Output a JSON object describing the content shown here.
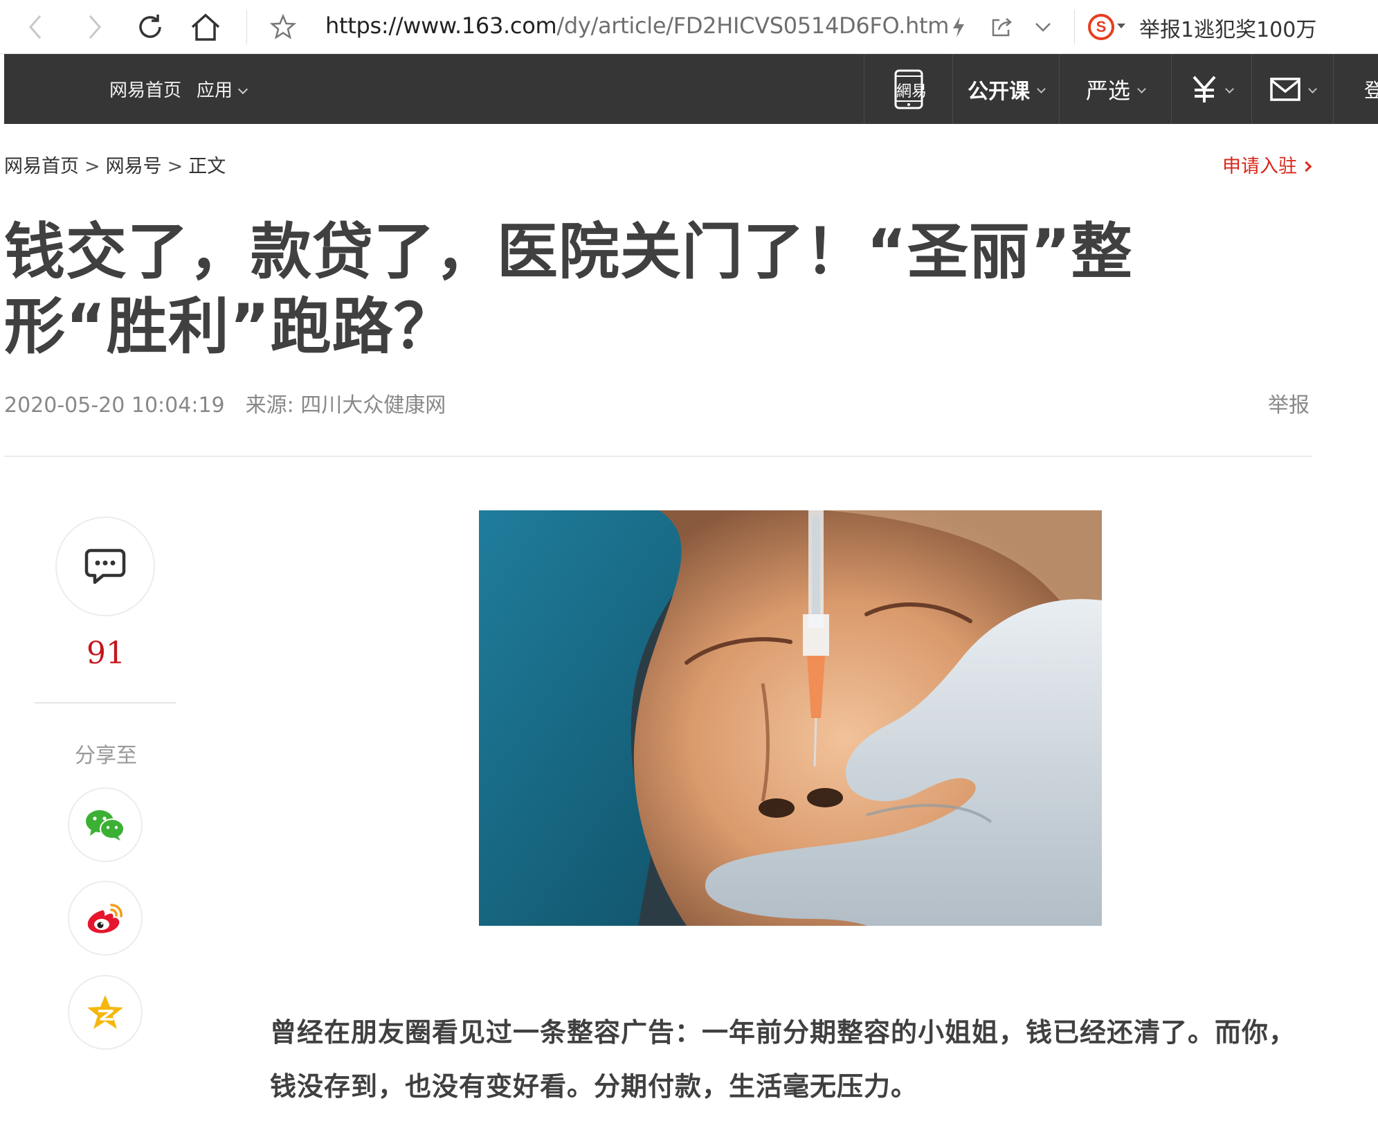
{
  "browser": {
    "url_host": "https://www.163.com",
    "url_path": "/dy/article/FD2HICVS0514D6FO.htm",
    "ticker": "举报1逃犯奖100万",
    "search_engine_letter": "S"
  },
  "site_nav": {
    "home": "网易首页",
    "apps": "应用",
    "mobile_logo": "網易",
    "open_course": "公开课",
    "yanxuan": "严选",
    "login": "登"
  },
  "breadcrumb": {
    "home": "网易首页",
    "section": "网易号",
    "current": "正文",
    "separator": ">"
  },
  "apply_link": "申请入驻",
  "article": {
    "title": "钱交了，款贷了，医院关门了！“圣丽”整形“胜利”跑路？",
    "datetime": "2020-05-20 10:04:19",
    "source": "来源: 四川大众健康网",
    "report": "举报",
    "lead": "曾经在朋友圈看见过一条整容广告：一年前分期整容的小姐姐，钱已经还清了。而你，钱没存到，也没有变好看。分期付款，生活毫无压力。"
  },
  "share_rail": {
    "comment_count": "91",
    "share_label": "分享至"
  },
  "colors": {
    "nav_bg": "#363636",
    "accent_red": "#d8281b",
    "count_red": "#c4161c",
    "wechat_green": "#3cb034",
    "weibo_red": "#e6162d",
    "qzone_yellow": "#f5b70e"
  },
  "icons": [
    "back-icon",
    "forward-icon",
    "reload-icon",
    "home-icon",
    "star-icon",
    "lightning-icon",
    "share-icon",
    "chevron-down-icon",
    "comment-icon",
    "wechat-icon",
    "weibo-icon",
    "qzone-icon",
    "mobile-icon",
    "yuan-icon",
    "mail-icon"
  ]
}
